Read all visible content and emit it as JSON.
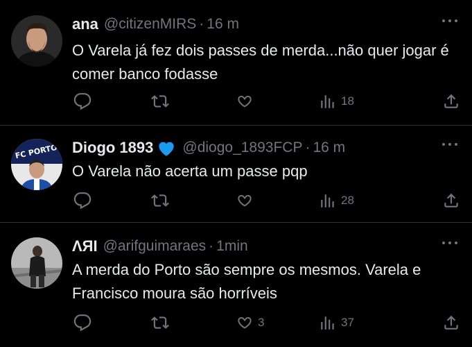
{
  "tweets": [
    {
      "name": "ana",
      "handle": "@citizenMIRS",
      "separator": "·",
      "time": "16 m",
      "text": "O Varela já fez dois passes de merda...não quer jogar é comer banco fodasse",
      "likes": "",
      "views": "18"
    },
    {
      "name": "Diogo 1893",
      "name_emoji": "blue-heart-icon",
      "avatar_text": "FC PORTO",
      "handle": "@diogo_1893FCP",
      "separator": "·",
      "time": "16 m",
      "text": "O Varela não acerta um passe pqp",
      "likes": "",
      "views": "28"
    },
    {
      "name": "ΛЯI",
      "handle": "@arifguimaraes",
      "separator": "·",
      "time": "1min",
      "text": "A merda do Porto são sempre os mesmos. Varela e Francisco moura são horríveis",
      "likes": "3",
      "views": "37"
    }
  ],
  "colors": {
    "background": "#000000",
    "text_primary": "#e7e9ea",
    "text_secondary": "#71767b",
    "divider": "#2f3336",
    "blue_heart": "#1d9bf0"
  }
}
